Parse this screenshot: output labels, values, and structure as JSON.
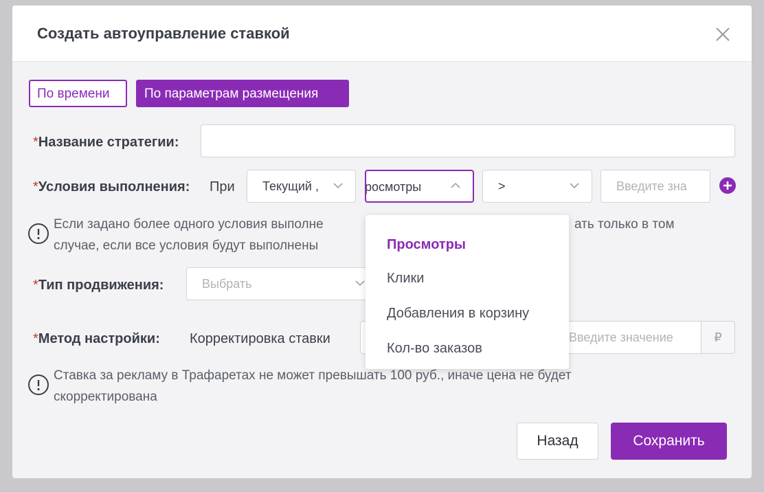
{
  "modal": {
    "title": "Создать автоуправление ставкой"
  },
  "tabs": [
    {
      "label": "По времени"
    },
    {
      "label": "По параметрам размещения"
    }
  ],
  "strategy_name": {
    "required_mark": "*",
    "label": "Название стратегии:",
    "value": ""
  },
  "conditions": {
    "required_mark": "*",
    "label": "Условия выполнения:",
    "prefix": "При",
    "metric_select": "Текущий ,",
    "type_select": "росмотры",
    "operator_select": ">",
    "value_placeholder": "Введите зна"
  },
  "conditions_notice": {
    "line1_a": "Если задано более одного условия выполне",
    "line1_b": "ать только в том",
    "line2": "случае, если все условия будут выполнены"
  },
  "promotion_type": {
    "required_mark": "*",
    "label": "Тип продвижения:",
    "placeholder": "Выбрать"
  },
  "method": {
    "required_mark": "*",
    "label": "Метод настройки:",
    "value": "Корректировка ставки",
    "amount_placeholder": "Введите значение",
    "currency": "₽"
  },
  "bid_notice": {
    "line1": "Ставка за рекламу в Трафаретах не может превышать 100 руб., иначе цена не будет",
    "line2": "скорректирована"
  },
  "dropdown": {
    "items": [
      {
        "label": "Просмотры"
      },
      {
        "label": "Клики"
      },
      {
        "label": "Добавления в корзину"
      },
      {
        "label": "Кол-во заказов"
      }
    ]
  },
  "buttons": {
    "back": "Назад",
    "save": "Сохранить"
  },
  "colors": {
    "accent": "#8a2bb5",
    "required": "#c0392b"
  }
}
